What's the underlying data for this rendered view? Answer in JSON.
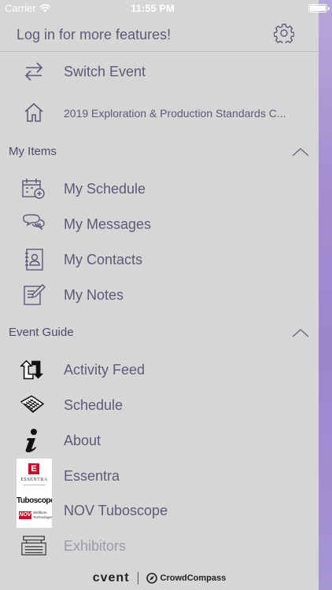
{
  "status": {
    "carrier": "Carrier",
    "time": "11:55 PM"
  },
  "header": {
    "login_text": "Log in for more features!"
  },
  "top_items": [
    {
      "label": "Switch Event",
      "icon": "switch-arrows-icon"
    },
    {
      "label": "2019 Exploration & Production Standards C...",
      "icon": "home-icon"
    }
  ],
  "my_items": {
    "title": "My Items",
    "items": [
      {
        "label": "My Schedule",
        "icon": "calendar-add-icon"
      },
      {
        "label": "My Messages",
        "icon": "chat-bubbles-icon"
      },
      {
        "label": "My Contacts",
        "icon": "contacts-book-icon"
      },
      {
        "label": "My Notes",
        "icon": "notes-icon"
      }
    ]
  },
  "event_guide": {
    "title": "Event Guide",
    "items": [
      {
        "label": "Activity Feed",
        "icon": "activity-arrows-icon"
      },
      {
        "label": "Schedule",
        "icon": "calendar-icon"
      },
      {
        "label": "About",
        "icon": "info-icon"
      },
      {
        "label": "Essentra",
        "icon": "essentra-logo"
      },
      {
        "label": "NOV Tuboscope",
        "icon": "tuboscope-logo"
      },
      {
        "label": "Exhibitors",
        "icon": "exhibitors-icon"
      }
    ]
  },
  "logos": {
    "essentra_mark": "E",
    "essentra_name": "ESSENTRA",
    "tuboscope_name": "Tuboscope",
    "nov_mark": "NOV",
    "nov_sub": "Wellbore Technologies"
  },
  "footer": {
    "brand1": "cvent",
    "brand2": "CrowdCompass"
  },
  "colors": {
    "panel_bg": "#d6d6d6",
    "text": "#5b5b78",
    "accent_strip": "#a58fd0"
  }
}
